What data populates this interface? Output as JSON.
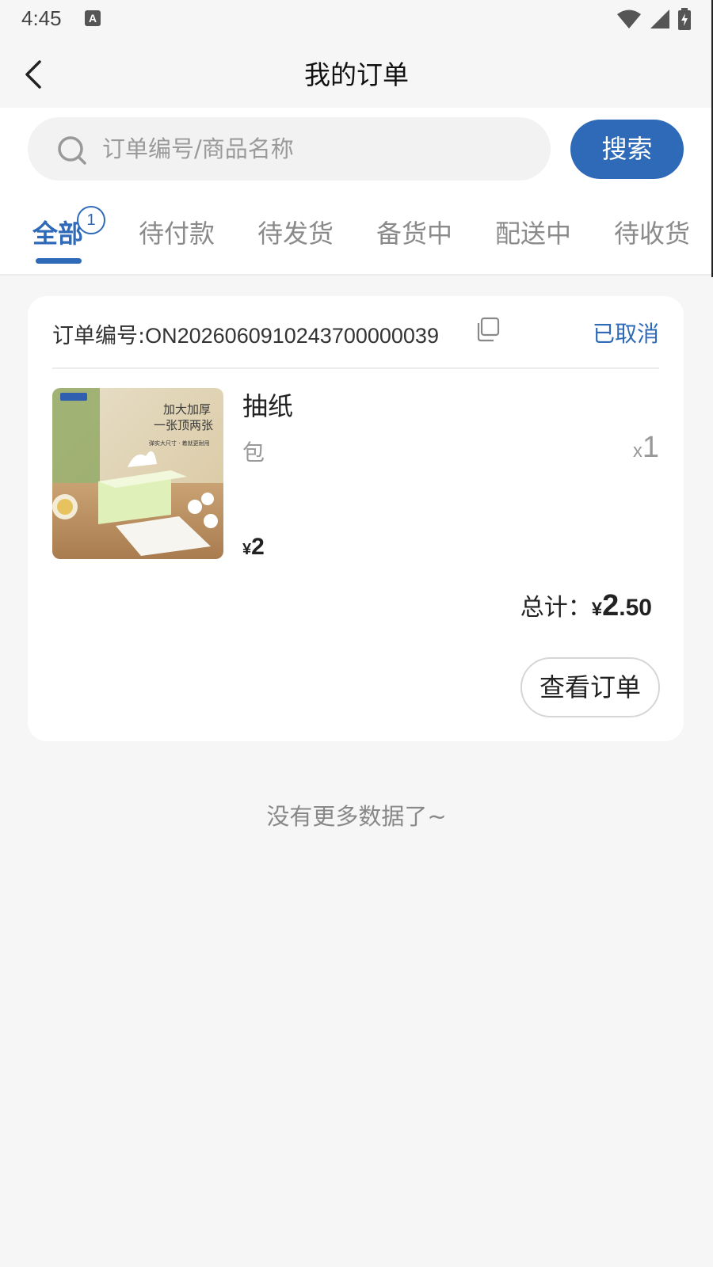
{
  "status_bar": {
    "time": "4:45",
    "notification_icon": "A"
  },
  "nav": {
    "title": "我的订单",
    "back_icon": "chevron-left-icon"
  },
  "search": {
    "placeholder": "订单编号/商品名称",
    "button_label": "搜索"
  },
  "tabs": [
    {
      "label": "全部",
      "active": true,
      "badge": "1"
    },
    {
      "label": "待付款",
      "active": false
    },
    {
      "label": "待发货",
      "active": false
    },
    {
      "label": "备货中",
      "active": false
    },
    {
      "label": "配送中",
      "active": false
    },
    {
      "label": "待收货",
      "active": false
    }
  ],
  "order": {
    "number_label": "订单编号:",
    "number": "ON2026060910243700000039",
    "status": "已取消",
    "product": {
      "name": "抽纸",
      "spec": "包",
      "qty_prefix": "x",
      "qty": "1",
      "price_symbol": "¥",
      "price": "2",
      "image_text_line1": "加大加厚",
      "image_text_line2": "一张顶两张",
      "image_text_line3": "弹实大尺寸 · 着就更耐用"
    },
    "total_label": "总计：",
    "total_symbol": "¥",
    "total_int": "2",
    "total_dec": ".50",
    "view_button": "查看订单"
  },
  "footer": {
    "no_more": "没有更多数据了~"
  },
  "colors": {
    "accent": "#2e6ab8",
    "background": "#f6f6f6"
  }
}
